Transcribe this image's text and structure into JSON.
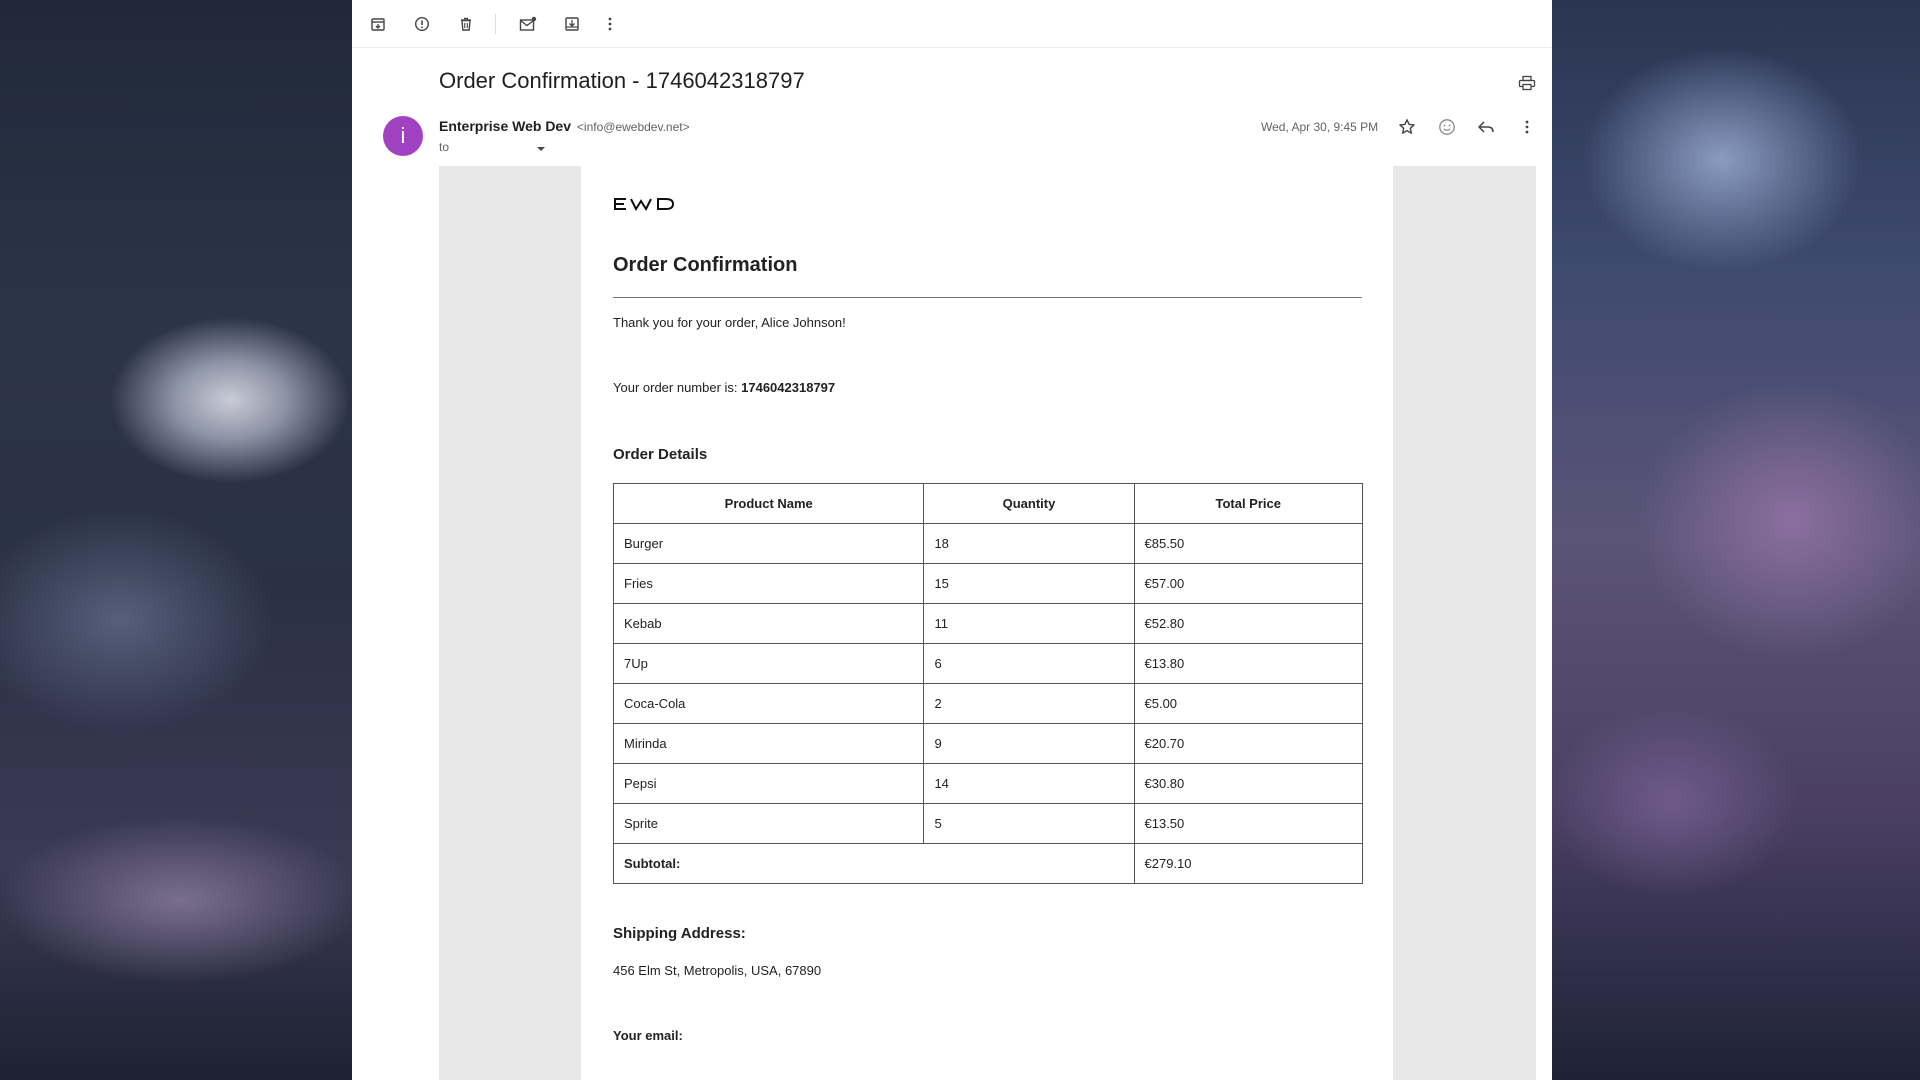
{
  "email": {
    "subject": "Order Confirmation - 1746042318797",
    "sender_initial": "i",
    "sender_name": "Enterprise Web Dev",
    "sender_email": "<info@ewebdev.net>",
    "to_label": "to",
    "date": "Wed, Apr 30, 9:45 PM"
  },
  "toolbar": {
    "icons": [
      "archive-icon",
      "report-spam-icon",
      "delete-icon",
      "mark-unread-icon",
      "move-to-icon",
      "more-icon"
    ]
  },
  "body": {
    "logo_text": "EWD",
    "title": "Order Confirmation",
    "thanks": "Thank you for your order, Alice Johnson!",
    "order_number_label": "Your order number is: ",
    "order_number": "1746042318797",
    "details_heading": "Order Details",
    "table": {
      "headers": [
        "Product Name",
        "Quantity",
        "Total Price"
      ],
      "rows": [
        [
          "Burger",
          "18",
          "€85.50"
        ],
        [
          "Fries",
          "15",
          "€57.00"
        ],
        [
          "Kebab",
          "11",
          "€52.80"
        ],
        [
          "7Up",
          "6",
          "€13.80"
        ],
        [
          "Coca-Cola",
          "2",
          "€5.00"
        ],
        [
          "Mirinda",
          "9",
          "€20.70"
        ],
        [
          "Pepsi",
          "14",
          "€30.80"
        ],
        [
          "Sprite",
          "5",
          "€13.50"
        ]
      ],
      "subtotal_label": "Subtotal:",
      "subtotal_value": "€279.10"
    },
    "shipping_heading": "Shipping Address:",
    "shipping_address": "456 Elm St, Metropolis, USA, 67890",
    "email_heading": "Your email:"
  },
  "colors": {
    "avatar": "#a142c2",
    "mail_background": "#e8e8e8"
  }
}
